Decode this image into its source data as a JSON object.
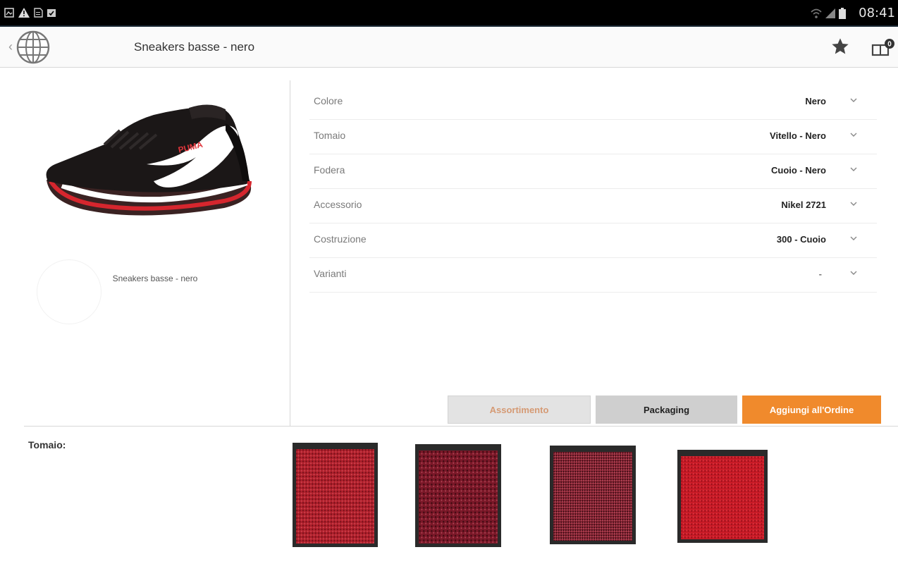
{
  "status_bar": {
    "time": "08:41",
    "left_icons": [
      "gallery-icon",
      "warning-icon",
      "document-icon",
      "calendar-check-icon"
    ],
    "right_icons": [
      "wifi-icon",
      "signal-icon",
      "battery-icon"
    ]
  },
  "action_bar": {
    "title": "Sneakers basse - nero",
    "icons": [
      "back-chevron-icon",
      "globe-icon",
      "star-icon",
      "cart-icon"
    ],
    "cart_badge": "0"
  },
  "product": {
    "caption": "Sneakers basse - nero",
    "shoe_brand_mark": "PUMA"
  },
  "options": [
    {
      "label": "Colore",
      "value": "Nero"
    },
    {
      "label": "Tomaio",
      "value": "Vitello - Nero"
    },
    {
      "label": "Fodera",
      "value": "Cuoio - Nero"
    },
    {
      "label": "Accessorio",
      "value": "Nikel 2721"
    },
    {
      "label": "Costruzione",
      "value": "300 - Cuoio"
    },
    {
      "label": "Varianti",
      "value": "-"
    }
  ],
  "buttons": {
    "assortimento": "Assortimento",
    "packaging": "Packaging",
    "add_to_order": "Aggiungi all'Ordine"
  },
  "swatches": {
    "label": "Tomaio:",
    "colors": [
      "#b0202c",
      "#7a1828",
      "#8c2434",
      "#c81a26"
    ]
  }
}
